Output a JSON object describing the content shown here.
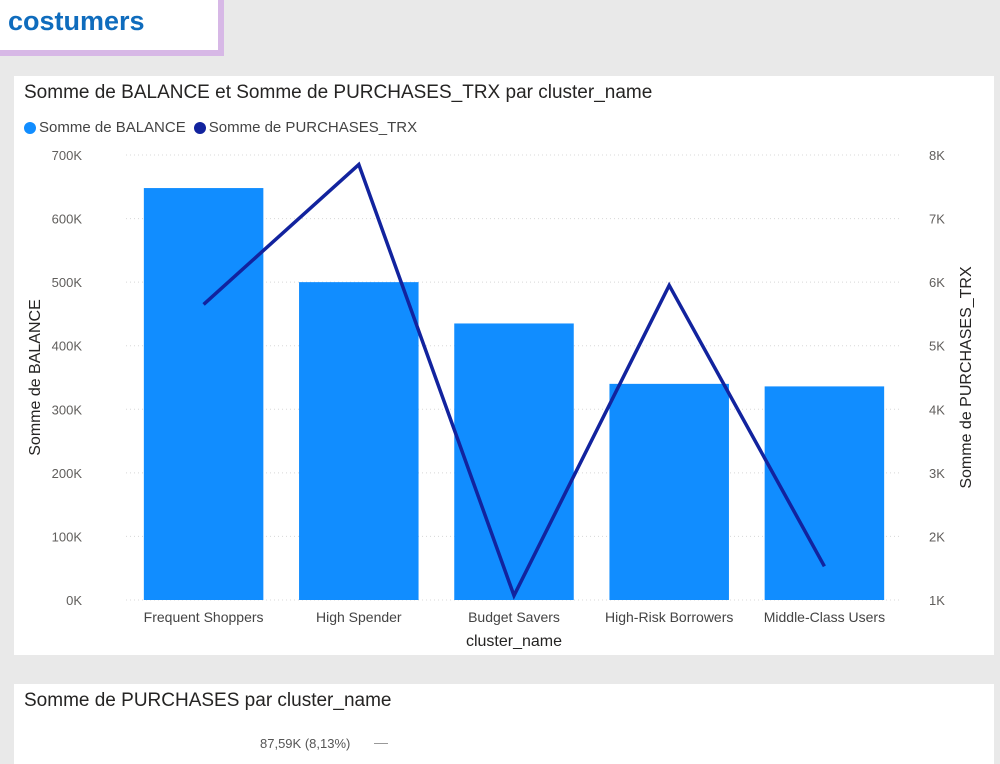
{
  "header": {
    "title": "costumers"
  },
  "top_chart": {
    "title": "Somme de BALANCE et Somme de PURCHASES_TRX par cluster_name",
    "legend": [
      {
        "label": "Somme de BALANCE",
        "color": "#118dff"
      },
      {
        "label": "Somme de PURCHASES_TRX",
        "color": "#12239e"
      }
    ]
  },
  "bottom_chart": {
    "title": "Somme de PURCHASES par cluster_name",
    "slice_label": "87,59K (8,13%)"
  },
  "chart_data": [
    {
      "type": "bar",
      "title": "Somme de BALANCE et Somme de PURCHASES_TRX par cluster_name",
      "xlabel": "cluster_name",
      "ylabel": "Somme de BALANCE",
      "y2label": "Somme de PURCHASES_TRX",
      "categories": [
        "Frequent Shoppers",
        "High Spender",
        "Budget Savers",
        "High-Risk Borrowers",
        "Middle-Class Users"
      ],
      "ylim": [
        0,
        700000
      ],
      "y2lim": [
        1000,
        8000
      ],
      "yticks": [
        "0K",
        "100K",
        "200K",
        "300K",
        "400K",
        "500K",
        "600K",
        "700K"
      ],
      "y2ticks": [
        "1K",
        "2K",
        "3K",
        "4K",
        "5K",
        "6K",
        "7K",
        "8K"
      ],
      "grid": true,
      "legend_position": "top-left",
      "series": [
        {
          "name": "Somme de BALANCE",
          "kind": "bar",
          "axis": "left",
          "color": "#118dff",
          "values": [
            648000,
            500000,
            435000,
            340000,
            336000
          ]
        },
        {
          "name": "Somme de PURCHASES_TRX",
          "kind": "line",
          "axis": "right",
          "color": "#12239e",
          "values": [
            5650,
            7850,
            1070,
            5950,
            1530
          ]
        }
      ]
    },
    {
      "type": "pie",
      "title": "Somme de PURCHASES par cluster_name",
      "data_labels": [
        "87,59K (8,13%)"
      ]
    }
  ]
}
